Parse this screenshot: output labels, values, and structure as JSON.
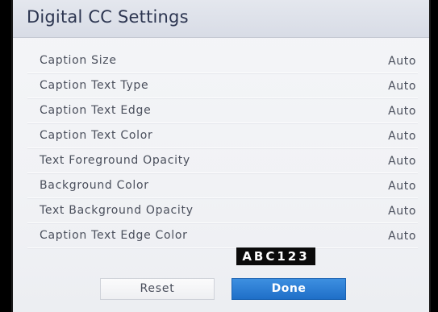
{
  "title": "Digital CC Settings",
  "settings": [
    {
      "label": "Caption Size",
      "value": "Auto"
    },
    {
      "label": "Caption Text Type",
      "value": "Auto"
    },
    {
      "label": "Caption Text Edge",
      "value": "Auto"
    },
    {
      "label": "Caption Text Color",
      "value": "Auto"
    },
    {
      "label": "Text Foreground Opacity",
      "value": "Auto"
    },
    {
      "label": "Background Color",
      "value": "Auto"
    },
    {
      "label": "Text Background Opacity",
      "value": "Auto"
    },
    {
      "label": "Caption Text Edge Color",
      "value": "Auto"
    }
  ],
  "preview_text": "ABC123",
  "buttons": {
    "reset_label": "Reset",
    "done_label": "Done"
  },
  "colors": {
    "accent": "#2a7bd3",
    "title_text": "#2c3550",
    "preview_bg": "#0b0b0b",
    "preview_text": "#ffffff"
  }
}
